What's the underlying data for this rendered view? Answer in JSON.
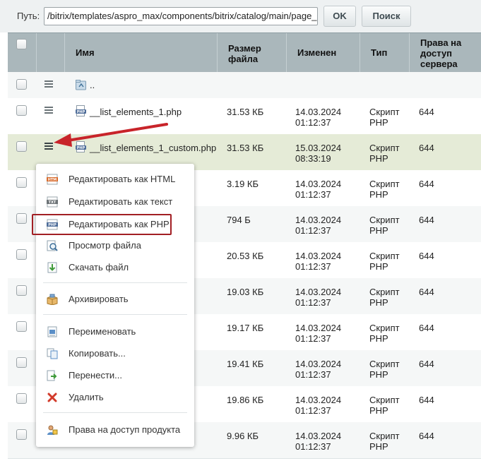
{
  "pathbar": {
    "label": "Путь:",
    "value": "/bitrix/templates/aspro_max/components/bitrix/catalog/main/page_",
    "ok_label": "OK",
    "search_label": "Поиск"
  },
  "table": {
    "headers": {
      "name": "Имя",
      "size_l1": "Размер",
      "size_l2": "файла",
      "date": "Изменен",
      "type": "Тип",
      "rights_l1": "Права на",
      "rights_l2": "доступ",
      "rights_l3": "сервера"
    },
    "rows": [
      {
        "name": "..",
        "size": "",
        "date1": "",
        "date2": "",
        "type1": "",
        "type2": "",
        "rights": ""
      },
      {
        "name": "__list_elements_1.php",
        "size": "31.53 КБ",
        "date1": "14.03.2024",
        "date2": "01:12:37",
        "type1": "Скрипт",
        "type2": "PHP",
        "rights": "644"
      },
      {
        "name": "__list_elements_1_custom.php",
        "size": "31.53 КБ",
        "date1": "15.03.2024",
        "date2": "08:33:19",
        "type1": "Скрипт",
        "type2": "PHP",
        "rights": "644"
      },
      {
        "name": "",
        "size": "3.19 КБ",
        "date1": "14.03.2024",
        "date2": "01:12:37",
        "type1": "Скрипт",
        "type2": "PHP",
        "rights": "644"
      },
      {
        "name": "",
        "size": "794 Б",
        "date1": "14.03.2024",
        "date2": "01:12:37",
        "type1": "Скрипт",
        "type2": "PHP",
        "rights": "644"
      },
      {
        "name": "",
        "size": "20.53 КБ",
        "date1": "14.03.2024",
        "date2": "01:12:37",
        "type1": "Скрипт",
        "type2": "PHP",
        "rights": "644"
      },
      {
        "name": "",
        "size": "19.03 КБ",
        "date1": "14.03.2024",
        "date2": "01:12:37",
        "type1": "Скрипт",
        "type2": "PHP",
        "rights": "644"
      },
      {
        "name": "",
        "size": "19.17 КБ",
        "date1": "14.03.2024",
        "date2": "01:12:37",
        "type1": "Скрипт",
        "type2": "PHP",
        "rights": "644"
      },
      {
        "name": "",
        "size": "19.41 КБ",
        "date1": "14.03.2024",
        "date2": "01:12:37",
        "type1": "Скрипт",
        "type2": "PHP",
        "rights": "644"
      },
      {
        "name": "",
        "size": "19.86 КБ",
        "date1": "14.03.2024",
        "date2": "01:12:37",
        "type1": "Скрипт",
        "type2": "PHP",
        "rights": "644"
      },
      {
        "name": "",
        "size": "9.96 КБ",
        "date1": "14.03.2024",
        "date2": "01:12:37",
        "type1": "Скрипт",
        "type2": "PHP",
        "rights": "644"
      }
    ]
  },
  "context_menu": {
    "items": [
      {
        "label": "Редактировать как HTML",
        "icon": "edit-html-icon"
      },
      {
        "label": "Редактировать как текст",
        "icon": "edit-text-icon"
      },
      {
        "label": "Редактировать как PHP",
        "icon": "edit-php-icon"
      },
      {
        "label": "Просмотр файла",
        "icon": "view-file-icon"
      },
      {
        "label": "Скачать файл",
        "icon": "download-icon"
      },
      {
        "label": "Архивировать",
        "icon": "archive-icon"
      },
      {
        "label": "Переименовать",
        "icon": "rename-icon"
      },
      {
        "label": "Копировать...",
        "icon": "copy-icon"
      },
      {
        "label": "Перенести...",
        "icon": "move-icon"
      },
      {
        "label": "Удалить",
        "icon": "delete-icon"
      },
      {
        "label": "Права на доступ продукта",
        "icon": "access-rights-icon"
      }
    ],
    "highlight_color": "#a21f24"
  },
  "colors": {
    "header_bg": "#aab7bb",
    "selected_row_bg": "#e5ebd7",
    "arrow": "#c8242a"
  }
}
